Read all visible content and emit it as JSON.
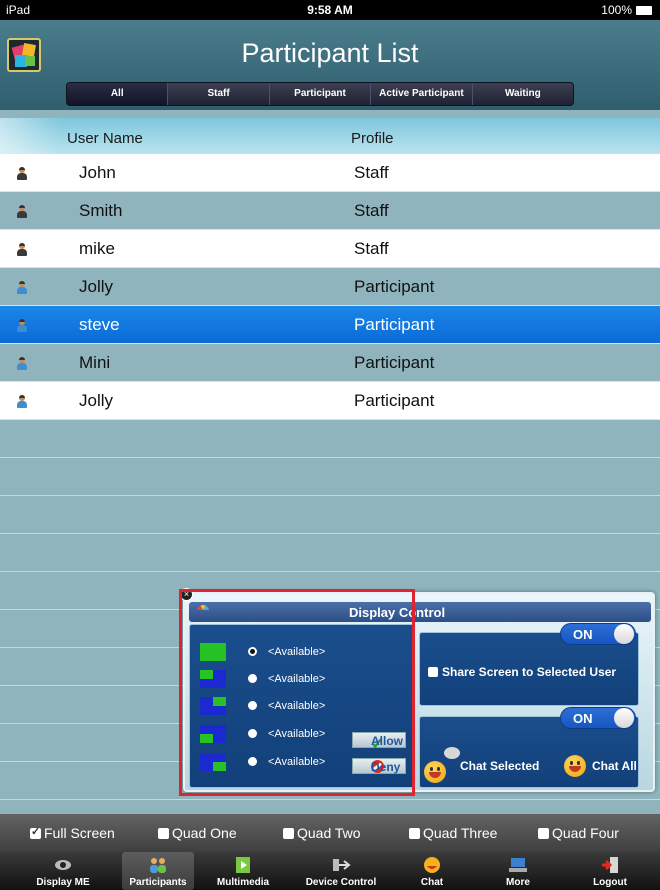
{
  "status_bar": {
    "device": "iPad",
    "time": "9:58 AM",
    "battery": "100%"
  },
  "header": {
    "title": "Participant List"
  },
  "filter_tabs": [
    {
      "label": "All"
    },
    {
      "label": "Staff"
    },
    {
      "label": "Participant"
    },
    {
      "label": "Active Participant"
    },
    {
      "label": "Waiting"
    }
  ],
  "active_filter": "All",
  "columns": {
    "user_name": "User Name",
    "profile": "Profile"
  },
  "participants": [
    {
      "name": "John",
      "profile": "Staff",
      "icon": "staff-user-icon"
    },
    {
      "name": "Smith",
      "profile": "Staff",
      "icon": "staff-user-icon"
    },
    {
      "name": "mike",
      "profile": "Staff",
      "icon": "staff-user-icon"
    },
    {
      "name": "Jolly",
      "profile": "Participant",
      "icon": "participant-user-icon"
    },
    {
      "name": "steve",
      "profile": "Participant",
      "icon": "participant-user-icon",
      "selected": true
    },
    {
      "name": "Mini",
      "profile": "Participant",
      "icon": "participant-user-icon"
    },
    {
      "name": "Jolly",
      "profile": "Participant",
      "icon": "participant-user-icon"
    }
  ],
  "display_control": {
    "title": "Display Control",
    "slots": [
      {
        "label": "<Available>",
        "selected": true
      },
      {
        "label": "<Available>",
        "selected": false
      },
      {
        "label": "<Available>",
        "selected": false
      },
      {
        "label": "<Available>",
        "selected": false
      },
      {
        "label": "<Available>",
        "selected": false
      }
    ],
    "allow_label": "Allow",
    "deny_label": "Deny",
    "share_toggle": "ON",
    "share_label": "Share Screen to Selected User",
    "chat_toggle": "ON",
    "chat_selected_label": "Chat Selected",
    "chat_all_label": "Chat All"
  },
  "screen_modes": [
    {
      "label": "Full Screen",
      "checked": true
    },
    {
      "label": "Quad One",
      "checked": false
    },
    {
      "label": "Quad Two",
      "checked": false
    },
    {
      "label": "Quad Three",
      "checked": false
    },
    {
      "label": "Quad Four",
      "checked": false
    }
  ],
  "tab_bar": [
    {
      "label": "Display ME",
      "icon": "eye-icon"
    },
    {
      "label": "Participants",
      "icon": "participants-icon",
      "active": true
    },
    {
      "label": "Multimedia",
      "icon": "multimedia-icon"
    },
    {
      "label": "Device Control",
      "icon": "device-control-icon"
    },
    {
      "label": "Chat",
      "icon": "chat-icon"
    },
    {
      "label": "More",
      "icon": "more-icon"
    },
    {
      "label": "Logout",
      "icon": "logout-icon"
    }
  ],
  "colors": {
    "selected_row": "#0b6bd6",
    "popup_pane": "#1a4e8c",
    "highlight_frame": "#e0242f"
  }
}
